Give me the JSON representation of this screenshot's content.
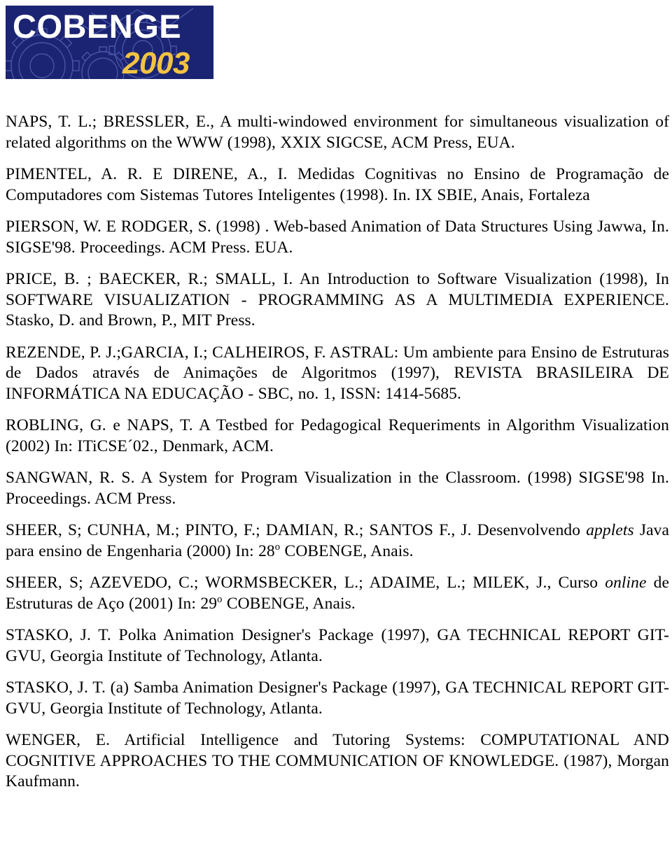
{
  "logo": {
    "name": "cobenge-2003-logo",
    "title_text": "COBENGE",
    "year_text": "2003",
    "bg_color": "#1b2472",
    "title_color": "#ffffff",
    "year_color": "#f2c341",
    "gear_stroke_color": "#4a56a8"
  },
  "references": [
    {
      "id": "naps-bressler",
      "parts": [
        {
          "type": "text",
          "value": "NAPS, T. L.; BRESSLER, E., A multi-windowed environment for  simultaneous visualization of related algorithms on the WWW (1998), XXIX SIGCSE, ACM Press, EUA."
        }
      ]
    },
    {
      "id": "pimentel-direne",
      "parts": [
        {
          "type": "text",
          "value": "PIMENTEL, A. R. E DIRENE, A., I. Medidas  Cognitivas no Ensino  de Programação de Computadores com Sistemas  Tutores Inteligentes (1998).  In. IX SBIE, Anais, Fortaleza"
        }
      ]
    },
    {
      "id": "pierson-rodger",
      "parts": [
        {
          "type": "text",
          "value": "PIERSON, W. E RODGER, S. (1998) . Web-based  Animation of Data  Structures  Using Jawwa, In. SIGSE'98. Proceedings. ACM Press. EUA."
        }
      ]
    },
    {
      "id": "price-baecker-small",
      "parts": [
        {
          "type": "text",
          "value": "PRICE, B. ; BAECKER, R.; SMALL, I.  An Introduction to Software Visualization  (1998), In   SOFTWARE VISUALIZATION - PROGRAMMING AS A MULTIMEDIA EXPERIENCE. Stasko, D. and Brown, P., MIT Press."
        }
      ]
    },
    {
      "id": "rezende-garcia-calheiros",
      "parts": [
        {
          "type": "text",
          "value": "REZENDE, P. J.;GARCIA, I.; CALHEIROS, F.  ASTRAL: Um ambiente para Ensino de Estruturas de Dados através de  Animações de Algoritmos (1997), REVISTA BRASILEIRA DE INFORMÁTICA NA EDUCAÇÃO - SBC, no. 1, ISSN: 1414-5685."
        }
      ]
    },
    {
      "id": "robling-naps",
      "parts": [
        {
          "type": "text",
          "value": "ROBLING, G. e NAPS, T.  A  Testbed for Pedagogical Requeriments in Algorithm Visualization (2002) In:  ITiCSE´02., Denmark, ACM."
        }
      ]
    },
    {
      "id": "sangwan",
      "parts": [
        {
          "type": "text",
          "value": "SANGWAN, R. S. A System for Program  Visualization in the  Classroom. (1998)  SIGSE'98 In. Proceedings.  ACM Press."
        }
      ]
    },
    {
      "id": "sheer-cunha-pinto-damian-santos",
      "parts": [
        {
          "type": "text",
          "value": "SHEER, S; CUNHA, M.; PINTO, F.; DAMIAN, R.; SANTOS F., J. Desenvolvendo "
        },
        {
          "type": "italic",
          "value": "applets"
        },
        {
          "type": "text",
          "value": " Java para ensino de Engenharia (2000)  In: 28"
        },
        {
          "type": "sup",
          "value": "o"
        },
        {
          "type": "text",
          "value": " COBENGE, Anais."
        }
      ]
    },
    {
      "id": "sheer-azevedo-wormsbecker-adaime-milek",
      "parts": [
        {
          "type": "text",
          "value": "SHEER, S; AZEVEDO, C.; WORMSBECKER, L.; ADAIME, L.; MILEK, J., Curso "
        },
        {
          "type": "italic",
          "value": "online"
        },
        {
          "type": "text",
          "value": " de Estruturas de Aço (2001)  In: 29"
        },
        {
          "type": "sup",
          "value": "o"
        },
        {
          "type": "text",
          "value": " COBENGE, Anais."
        }
      ]
    },
    {
      "id": "stasko-polka",
      "parts": [
        {
          "type": "text",
          "value": "STASKO, J. T.  Polka Animation Designer's Package (1997), GA TECHNICAL REPORT GIT-GVU, Georgia Institute of Technology, Atlanta."
        }
      ]
    },
    {
      "id": "stasko-samba",
      "parts": [
        {
          "type": "text",
          "value": "STASKO, J. T. (a)   Samba Animation Designer's Package (1997), GA TECHNICAL REPORT GIT-GVU, Georgia Institute of Technology, Atlanta."
        }
      ]
    },
    {
      "id": "wenger",
      "parts": [
        {
          "type": "text",
          "value": "WENGER, E. Artificial Intelligence and  Tutoring Systems:  COMPUTATIONAL AND COGNITIVE APPROACHES TO THE COMMUNICATION OF  KNOWLEDGE. (1987), Morgan Kaufmann."
        }
      ]
    }
  ]
}
